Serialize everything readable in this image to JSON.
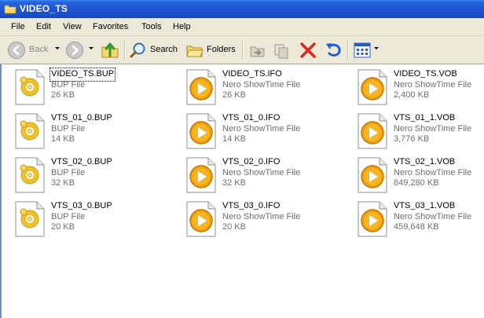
{
  "window": {
    "title": "VIDEO_TS"
  },
  "menu": [
    "File",
    "Edit",
    "View",
    "Favorites",
    "Tools",
    "Help"
  ],
  "toolbar": {
    "back_label": "Back",
    "search_label": "Search",
    "folders_label": "Folders"
  },
  "files": [
    {
      "name": "VIDEO_TS.BUP",
      "type": "BUP File",
      "size": "26 KB",
      "icon": "bup-file-icon"
    },
    {
      "name": "VIDEO_TS.IFO",
      "type": "Nero ShowTime File",
      "size": "26 KB",
      "icon": "nero-showtime-icon"
    },
    {
      "name": "VIDEO_TS.VOB",
      "type": "Nero ShowTime File",
      "size": "2,400 KB",
      "icon": "nero-showtime-icon"
    },
    {
      "name": "VTS_01_0.BUP",
      "type": "BUP File",
      "size": "14 KB",
      "icon": "bup-file-icon"
    },
    {
      "name": "VTS_01_0.IFO",
      "type": "Nero ShowTime File",
      "size": "14 KB",
      "icon": "nero-showtime-icon"
    },
    {
      "name": "VTS_01_1.VOB",
      "type": "Nero ShowTime File",
      "size": "3,776 KB",
      "icon": "nero-showtime-icon"
    },
    {
      "name": "VTS_02_0.BUP",
      "type": "BUP File",
      "size": "32 KB",
      "icon": "bup-file-icon"
    },
    {
      "name": "VTS_02_0.IFO",
      "type": "Nero ShowTime File",
      "size": "32 KB",
      "icon": "nero-showtime-icon"
    },
    {
      "name": "VTS_02_1.VOB",
      "type": "Nero ShowTime File",
      "size": "849,280 KB",
      "icon": "nero-showtime-icon"
    },
    {
      "name": "VTS_03_0.BUP",
      "type": "BUP File",
      "size": "20 KB",
      "icon": "bup-file-icon"
    },
    {
      "name": "VTS_03_0.IFO",
      "type": "Nero ShowTime File",
      "size": "20 KB",
      "icon": "nero-showtime-icon"
    },
    {
      "name": "VTS_03_1.VOB",
      "type": "Nero ShowTime File",
      "size": "459,648 KB",
      "icon": "nero-showtime-icon"
    }
  ],
  "colors": {
    "titlebar": "#2458d8",
    "chrome": "#ece9d8",
    "nero_orange": "#f0a010",
    "bup_gold": "#f2c22a"
  }
}
